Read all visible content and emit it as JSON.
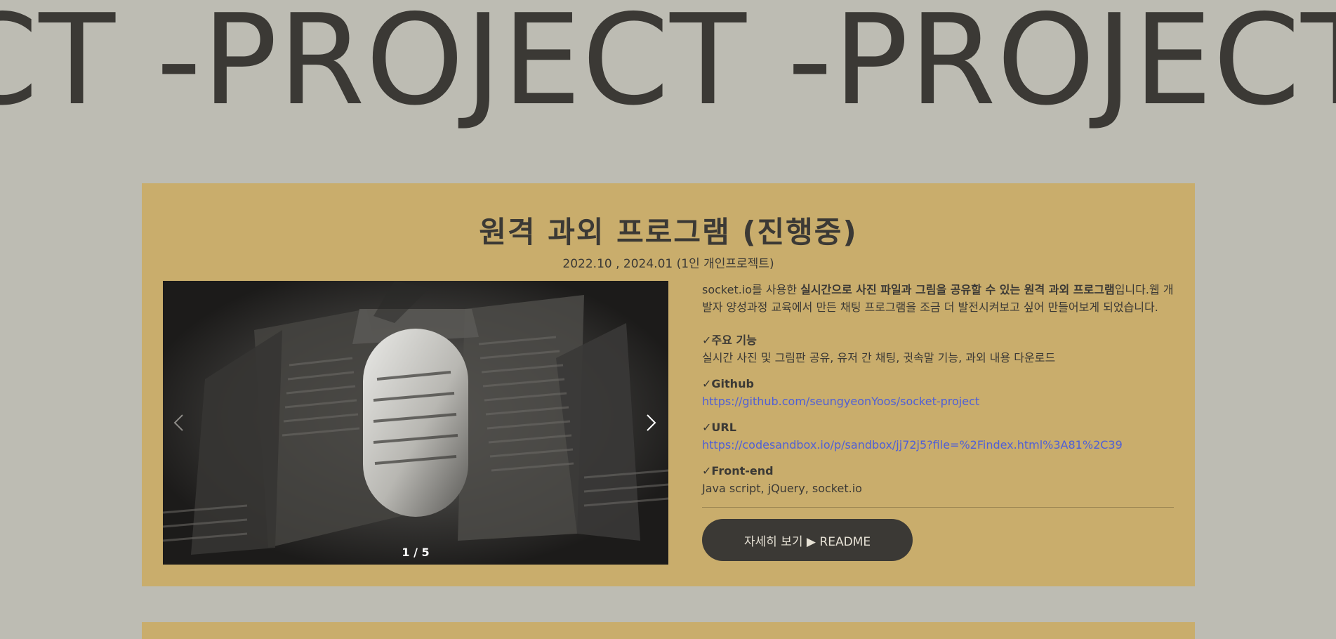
{
  "marquee": {
    "segments": [
      "CT - ",
      "PROJECT - ",
      "PROJECT"
    ]
  },
  "project": {
    "title": "원격 과외 프로그램 (진행중)",
    "period": "2022.10 , 2024.01 (1인 개인프로젝트)",
    "slider": {
      "pagination": "1 / 5",
      "prev_icon": "chevron-left-icon",
      "next_icon": "chevron-right-icon"
    },
    "intro": {
      "prefix": "socket.io를 사용한 ",
      "highlight": "실시간으로 사진 파일과 그림을 공유할 수 있는 원격 과외 프로그램",
      "suffix": "입니다.웹 개발자 양성과정 교육에서 만든 채팅 프로그램을 조금 더 발전시켜보고 싶어 만들어보게 되었습니다."
    },
    "features": [
      {
        "title": "주요 기능",
        "body": "실시간 사진 및 그림판 공유, 유저 간 채팅, 귓속말 기능, 과외 내용 다운로드",
        "is_link": false
      },
      {
        "title": "Github",
        "body": "https://github.com/seungyeonYoos/socket-project",
        "is_link": true
      },
      {
        "title": "URL",
        "body": "https://codesandbox.io/p/sandbox/jj72j5?file=%2Findex.html%3A81%2C39",
        "is_link": true
      },
      {
        "title": "Front-end",
        "body": "Java script, jQuery, socket.io",
        "is_link": false
      }
    ],
    "check_mark": "✓",
    "readme_button": "자세히 보기 ▶ README"
  },
  "colors": {
    "background": "#bdbcb3",
    "card": "#c9ad6c",
    "text": "#3b3935",
    "link": "#4f5fd6"
  }
}
